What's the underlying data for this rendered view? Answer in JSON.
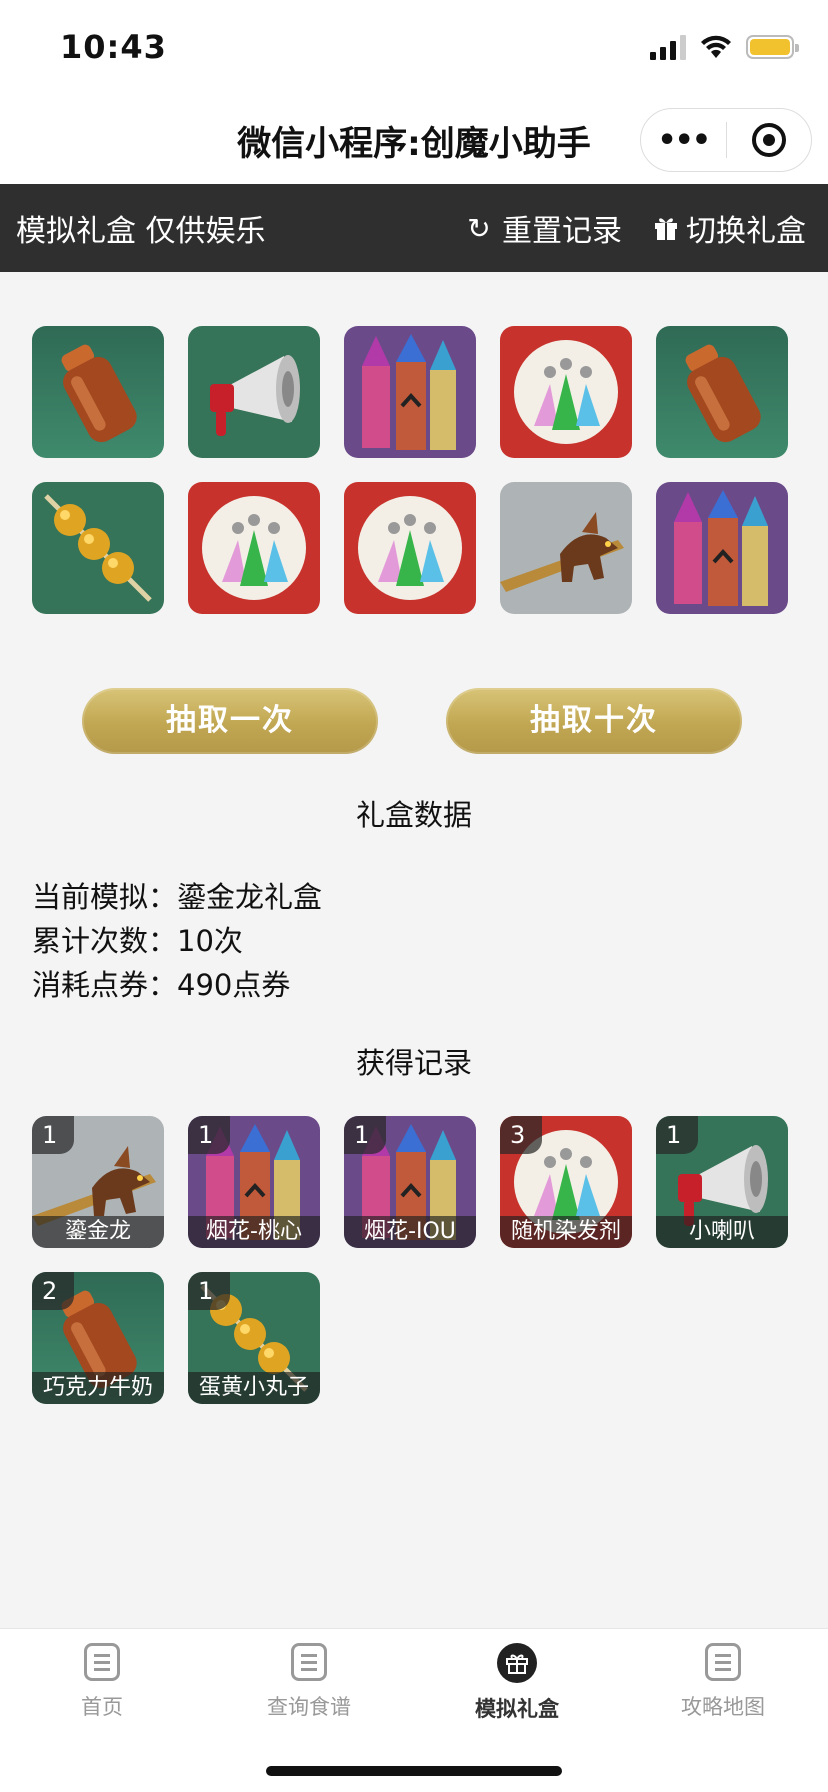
{
  "status": {
    "time": "10:43"
  },
  "nav": {
    "title": "微信小程序:创魔小助手",
    "more_label": "•••"
  },
  "toolbar": {
    "title": "模拟礼盒 仅供娱乐",
    "reset_label": "重置记录",
    "switch_label": "切换礼盒"
  },
  "draw_grid": [
    "milk-bottle-icon",
    "horn-icon",
    "fireworks-icon",
    "dye-icon",
    "milk-bottle-icon",
    "skewer-icon",
    "dye-icon",
    "dye-icon",
    "dragon-icon",
    "fireworks-icon"
  ],
  "buttons": {
    "draw_once": "抽取一次",
    "draw_ten": "抽取十次"
  },
  "box_data": {
    "title": "礼盒数据",
    "current_label": "当前模拟：",
    "current_value": "鎏金龙礼盒",
    "count_label": "累计次数：",
    "count_value": "10次",
    "cost_label": "消耗点券：",
    "cost_value": "490点券"
  },
  "records": {
    "title": "获得记录",
    "items": [
      {
        "name": "鎏金龙",
        "count": "1",
        "icon": "dragon-icon"
      },
      {
        "name": "烟花-桃心",
        "count": "1",
        "icon": "fireworks-icon"
      },
      {
        "name": "烟花-IOU",
        "count": "1",
        "icon": "fireworks-icon"
      },
      {
        "name": "随机染发剂",
        "count": "3",
        "icon": "dye-icon"
      },
      {
        "name": "小喇叭",
        "count": "1",
        "icon": "horn-icon"
      },
      {
        "name": "巧克力牛奶",
        "count": "2",
        "icon": "milk-bottle-icon"
      },
      {
        "name": "蛋黄小丸子",
        "count": "1",
        "icon": "skewer-icon"
      }
    ]
  },
  "tabs": [
    {
      "label": "首页",
      "active": false
    },
    {
      "label": "查询食谱",
      "active": false
    },
    {
      "label": "模拟礼盒",
      "active": true
    },
    {
      "label": "攻略地图",
      "active": false
    }
  ],
  "colors": {
    "toolbar_bg": "#2f2f2f",
    "button_gold": "#c1a752",
    "page_bg": "#f4f4f4"
  }
}
